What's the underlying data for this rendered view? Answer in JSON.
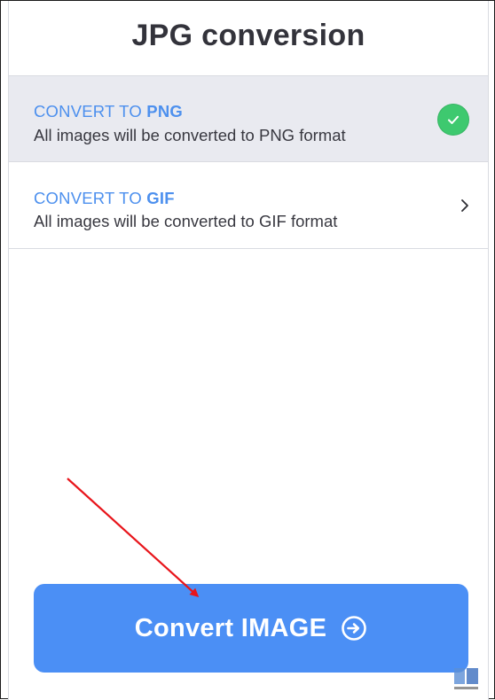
{
  "header": {
    "title": "JPG conversion"
  },
  "options": [
    {
      "prefix": "CONVERT TO ",
      "format": "PNG",
      "description": "All images will be converted to PNG format",
      "selected": true,
      "indicator_icon": "check-circle-icon"
    },
    {
      "prefix": "CONVERT TO ",
      "format": "GIF",
      "description": "All images will be converted to GIF format",
      "selected": false,
      "indicator_icon": "chevron-right-icon"
    }
  ],
  "action": {
    "convert_label": "Convert IMAGE",
    "convert_icon": "arrow-right-circle-icon"
  },
  "colors": {
    "accent_blue": "#4d90ee",
    "button_blue": "#4b8ff5",
    "selected_row_bg": "#e9eaf0",
    "check_green": "#3ec96f",
    "annotation_red": "#e8151b"
  }
}
